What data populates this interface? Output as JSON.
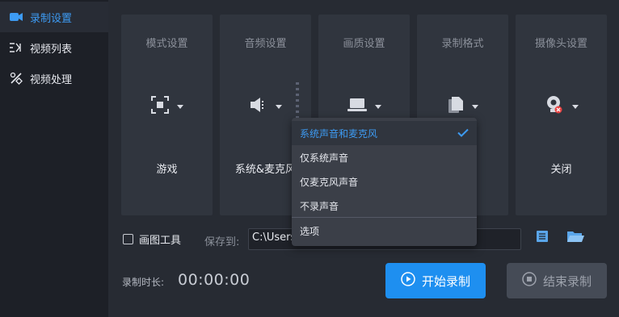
{
  "sidebar": {
    "items": [
      {
        "label": "录制设置",
        "icon": "video-camera-icon",
        "active": true
      },
      {
        "label": "视频列表",
        "icon": "list-icon",
        "active": false
      },
      {
        "label": "视频处理",
        "icon": "tools-icon",
        "active": false
      }
    ]
  },
  "cards": [
    {
      "title": "模式设置",
      "value": "游戏",
      "icon": "mode-target-icon"
    },
    {
      "title": "音频设置",
      "value": "系统&麦克风",
      "icon": "speaker-icon"
    },
    {
      "title": "画质设置",
      "value": "",
      "icon": "monitor-icon"
    },
    {
      "title": "录制格式",
      "value": "",
      "icon": "file-format-icon"
    },
    {
      "title": "摄像头设置",
      "value": "关闭",
      "icon": "webcam-off-icon"
    }
  ],
  "bottom": {
    "draw_tool_label": "画图工具",
    "save_to_label": "保存到:",
    "save_path": "C:\\Users",
    "duration_label": "录制时长:",
    "duration_value": "00:00:00",
    "start_label": "开始录制",
    "stop_label": "结束录制"
  },
  "audio_dropdown": {
    "items": [
      "系统声音和麦克风",
      "仅系统声音",
      "仅麦克风声音",
      "不录声音",
      "选项"
    ],
    "selected": "系统声音和麦克风"
  },
  "colors": {
    "accent": "#1e8ff0",
    "accent_text": "#3d9bf3",
    "background": "#1e2128",
    "card": "#30353e"
  }
}
